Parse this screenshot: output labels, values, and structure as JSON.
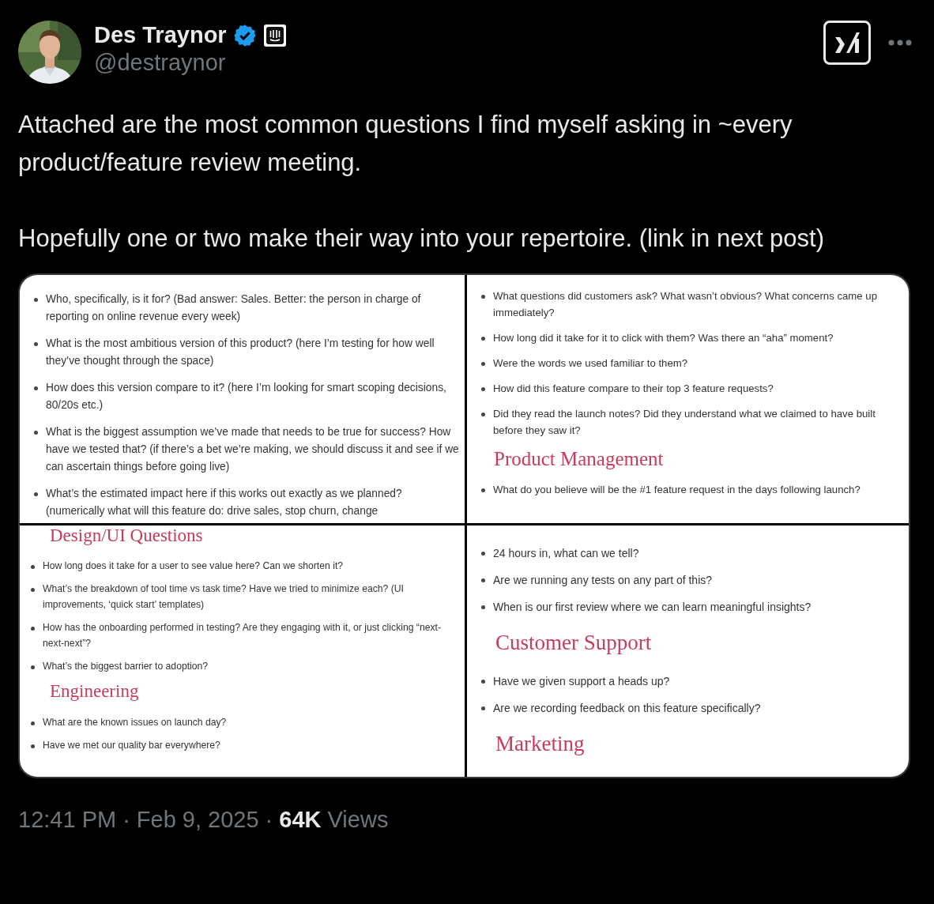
{
  "author": {
    "name": "Des Traynor",
    "handle": "@destraynor"
  },
  "text": [
    "Attached are the most common questions I find myself asking in ~every product/feature review meeting.",
    "Hopefully one or two make their way into your repertoire. (link in next post)"
  ],
  "panels": [
    {
      "blocks": [
        {
          "kind": "bullet",
          "text": "Who, specifically, is it for? (Bad answer: Sales. Better: the person in charge of reporting on online revenue every week)"
        },
        {
          "kind": "bullet",
          "text": "What is the most ambitious version of this product? (here I’m testing for how well they’ve thought through the space)"
        },
        {
          "kind": "bullet",
          "text": "How does this version compare to it? (here I’m looking for smart scoping decisions, 80/20s etc.)"
        },
        {
          "kind": "bullet",
          "text": "What is the biggest assumption we’ve made that needs to be true for success? How have we tested that? (if there’s a bet we’re making, we should discuss it and see if we can ascertain things before going live)"
        },
        {
          "kind": "bullet",
          "text": "What’s the estimated impact here if this works out exactly as we planned? (numerically what will this feature do: drive sales, stop churn, change"
        }
      ]
    },
    {
      "blocks": [
        {
          "kind": "bullet",
          "text": "What questions did customers ask? What wasn’t obvious? What concerns came up immediately?"
        },
        {
          "kind": "bullet",
          "text": "How long did it take for it to click with them? Was there an “aha” moment?"
        },
        {
          "kind": "bullet",
          "text": "Were the words we used familiar to them?"
        },
        {
          "kind": "bullet",
          "text": "How did this feature compare to their top 3 feature requests?"
        },
        {
          "kind": "bullet",
          "text": "Did they read the launch notes? Did they understand what we claimed to have built before they saw it?"
        },
        {
          "kind": "heading",
          "text": "Product Management"
        },
        {
          "kind": "bullet",
          "text": "What do you believe will be the #1 feature request in the days following launch?"
        }
      ]
    },
    {
      "blocks": [
        {
          "kind": "heading",
          "text": "Design/UI Questions"
        },
        {
          "kind": "bullet",
          "text": "How long does it take for a user to see value here? Can we shorten it?"
        },
        {
          "kind": "bullet",
          "text": "What’s the breakdown of tool time vs task time? Have we tried to minimize each? (UI improvements, ‘quick start’ templates)"
        },
        {
          "kind": "bullet",
          "text": "How has the onboarding performed in testing? Are they engaging with it, or just clicking “next-next-next”?"
        },
        {
          "kind": "bullet",
          "text": "What’s the biggest barrier to adoption?"
        },
        {
          "kind": "heading",
          "text": "Engineering"
        },
        {
          "kind": "bullet",
          "text": "What are the known issues on launch day?"
        },
        {
          "kind": "bullet",
          "text": "Have we met our quality bar everywhere?"
        }
      ]
    },
    {
      "blocks": [
        {
          "kind": "bullet",
          "text": "24 hours in, what can we tell?"
        },
        {
          "kind": "bullet",
          "text": "Are we running any tests on any part of this?"
        },
        {
          "kind": "bullet",
          "text": "When is our first review where we can learn meaningful insights?"
        },
        {
          "kind": "heading",
          "text": "Customer Support"
        },
        {
          "kind": "bullet",
          "text": "Have we given support a heads up?"
        },
        {
          "kind": "bullet",
          "text": "Are we recording feedback on this feature specifically?"
        },
        {
          "kind": "heading",
          "text": "Marketing"
        }
      ]
    }
  ],
  "footer": {
    "time": "12:41 PM",
    "separator_1": "·",
    "date": "Feb 9, 2025",
    "separator_2": "·",
    "views_count": "64K",
    "views_label": "Views"
  }
}
